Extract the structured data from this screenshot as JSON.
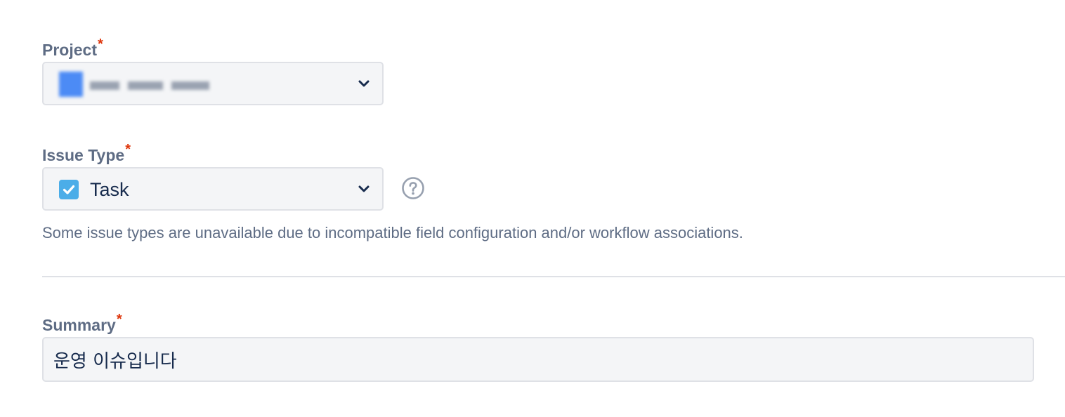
{
  "form": {
    "project": {
      "label": "Project",
      "required_marker": "*",
      "value_icon": "project-avatar-icon"
    },
    "issue_type": {
      "label": "Issue Type",
      "required_marker": "*",
      "value": "Task",
      "value_icon": "task-checkbox-icon",
      "icon_color": "#4bade8",
      "help_icon": "question-circle-icon",
      "note": "Some issue types are unavailable due to incompatible field configuration and/or workflow associations."
    },
    "summary": {
      "label": "Summary",
      "required_marker": "*",
      "value": "운영 이슈입니다"
    }
  },
  "colors": {
    "label": "#5e6c84",
    "required": "#de350b",
    "field_bg": "#f4f5f7",
    "field_border": "#dfe1e6",
    "text": "#172b4d"
  }
}
